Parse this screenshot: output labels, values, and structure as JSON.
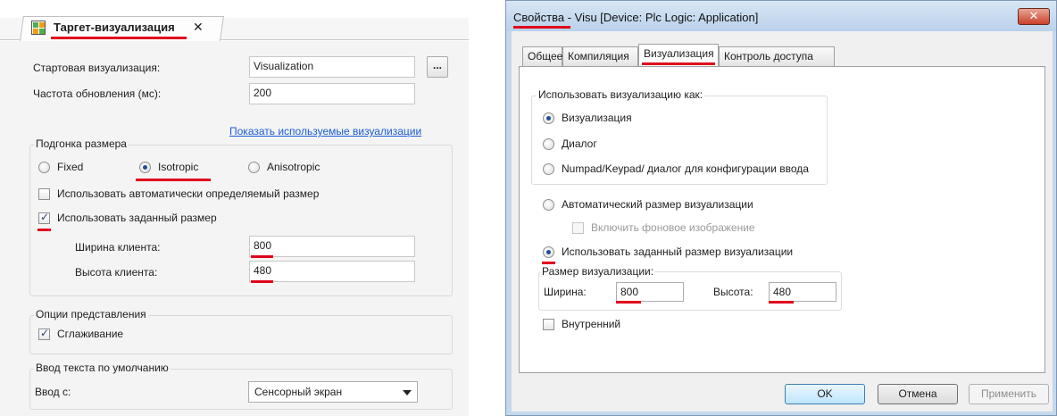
{
  "left": {
    "tab_title": "Таргет-визуализация",
    "tab_close": "✕",
    "start_vis_label": "Стартовая визуализация:",
    "start_vis_value": "Visualization",
    "browse_label": "...",
    "refresh_label": "Частота обновления (мс):",
    "refresh_value": "200",
    "show_used_link": "Показать используемые визуализации",
    "sizing_group": "Подгонка размера",
    "radio_fixed": "Fixed",
    "radio_isotropic": "Isotropic",
    "radio_anisotropic": "Anisotropic",
    "chk_auto_size": "Использовать автоматически определяемый размер",
    "chk_fixed_size": "Использовать заданный размер",
    "client_width_label": "Ширина клиента:",
    "client_width_value": "800",
    "client_height_label": "Высота клиента:",
    "client_height_value": "480",
    "display_group": "Опции представления",
    "chk_antialias": "Сглаживание",
    "text_input_group": "Ввод текста по умолчанию",
    "input_with_label": "Ввод с:",
    "input_with_value": "Сенсорный экран"
  },
  "dialog": {
    "title": "Свойства - Visu [Device: Plc Logic: Application]",
    "close_label": "✕",
    "tabs": [
      "Общее",
      "Компиляция",
      "Визуализация",
      "Контроль доступа"
    ],
    "use_as_group": "Использовать визуализацию как:",
    "radio_visualization": "Визуализация",
    "radio_dialog": "Диалог",
    "radio_numpad": "Numpad/Keypad/ диалог для конфигурации ввода",
    "radio_auto_size": "Автоматический размер визуализации",
    "chk_background": "Включить фоновое изображение",
    "radio_fixed_size": "Использовать заданный размер визуализации",
    "size_group": "Размер визуализации:",
    "width_label": "Ширина:",
    "width_value": "800",
    "height_label": "Высота:",
    "height_value": "480",
    "chk_internal": "Внутренний",
    "ok_label": "OK",
    "cancel_label": "Отмена",
    "apply_label": "Применить"
  },
  "colors": {
    "highlight_underline": "#e0001b",
    "link": "#1a5bd6",
    "dialog_frame": "#c4d8ec"
  }
}
